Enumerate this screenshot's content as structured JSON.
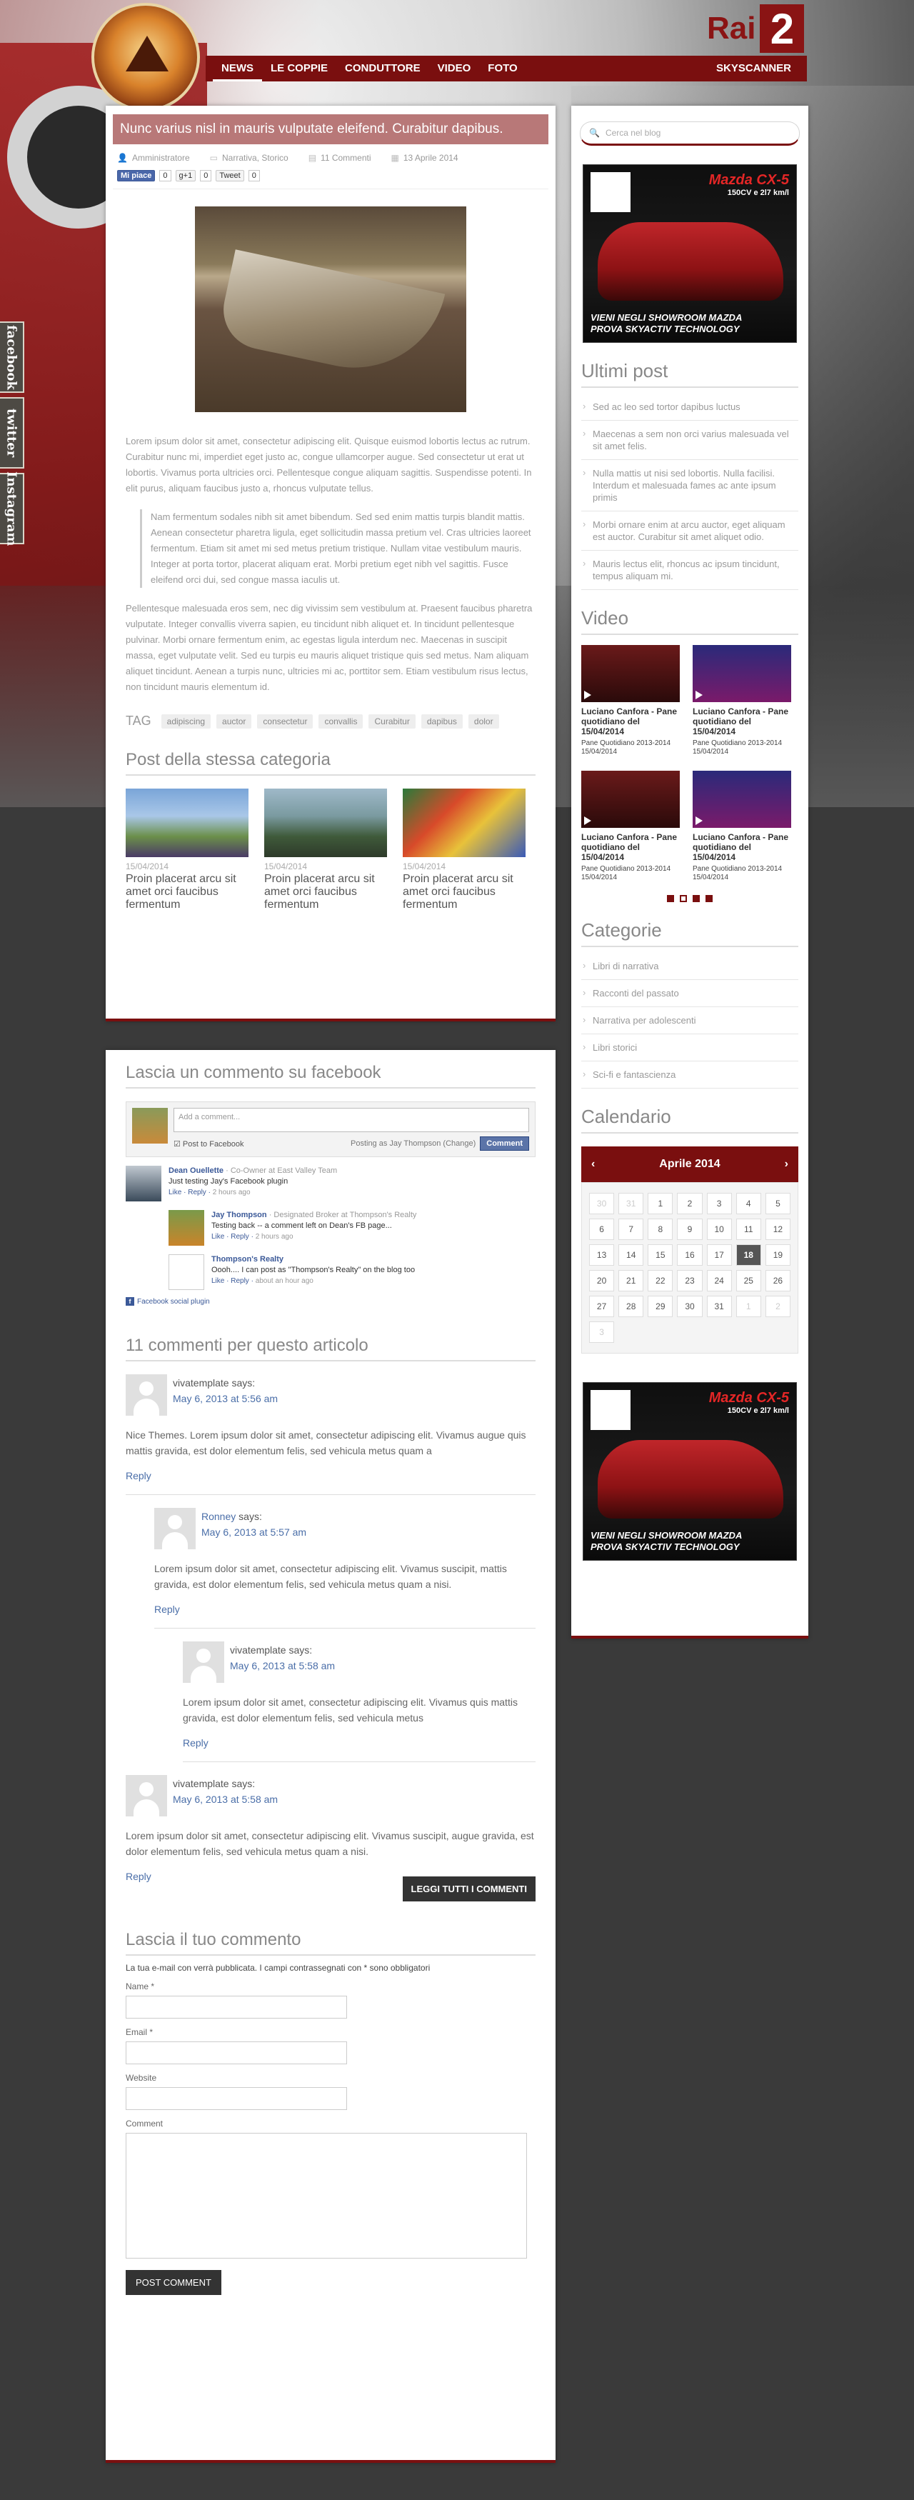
{
  "header": {
    "nav": [
      "NEWS",
      "LE COPPIE",
      "CONDUTTORE",
      "VIDEO",
      "FOTO"
    ],
    "nav_right": "SKYSCANNER",
    "brand": {
      "rai_text": "Rai",
      "rai_num": "2"
    }
  },
  "social_tabs": [
    "facebook",
    "twitter",
    "Instagram"
  ],
  "post": {
    "title": "Nunc varius nisl in mauris vulputate eleifend. Curabitur dapibus.",
    "meta": {
      "author": "Amministratore",
      "category": "Narrativa, Storico",
      "comments": "11 Commenti",
      "date": "13 Aprile 2014"
    },
    "share": {
      "fb": "Mi piace",
      "fb_count": "0",
      "gplus": "g+1",
      "gplus_count": "0",
      "tweet": "Tweet",
      "tweet_count": "0"
    },
    "paragraphs": [
      "Lorem ipsum dolor sit amet, consectetur adipiscing elit. Quisque euismod lobortis lectus ac rutrum. Curabitur nunc mi, imperdiet eget justo ac, congue ullamcorper augue. Sed consectetur ut erat ut lobortis. Vivamus porta ultricies orci. Pellentesque congue aliquam sagittis. Suspendisse potenti. In elit purus, aliquam faucibus justo a, rhoncus vulputate tellus.",
      "Nam fermentum sodales nibh sit amet bibendum. Sed sed enim mattis turpis blandit mattis. Aenean consectetur pharetra ligula, eget sollicitudin massa pretium vel. Cras ultricies laoreet fermentum. Etiam sit amet mi sed metus pretium tristique. Nullam vitae vestibulum mauris. Integer at porta tortor, placerat aliquam erat. Morbi pretium eget nibh vel sagittis. Fusce eleifend orci dui, sed congue massa iaculis ut.",
      "Pellentesque malesuada eros sem, nec dig vivissim sem vestibulum at. Praesent faucibus pharetra vulputate. Integer convallis viverra sapien, eu tincidunt nibh aliquet et. In tincidunt pellentesque pulvinar. Morbi ornare fermentum enim, ac egestas ligula interdum nec. Maecenas in suscipit massa, eget vulputate velit. Sed eu turpis eu mauris aliquet tristique quis sed metus. Nam aliquam aliquet tincidunt. Aenean a turpis nunc, ultricies mi ac, porttitor sem. Etiam vestibulum risus lectus, non tincidunt mauris elementum id."
    ],
    "tags_label": "TAG",
    "tags": [
      "adipiscing",
      "auctor",
      "consectetur",
      "convallis",
      "Curabitur",
      "dapibus",
      "dolor"
    ],
    "related_heading": "Post della stessa categoria",
    "related": [
      {
        "date": "15/04/2014",
        "title": "Proin placerat arcu sit amet orci faucibus fermentum"
      },
      {
        "date": "15/04/2014",
        "title": "Proin placerat arcu sit amet orci faucibus fermentum"
      },
      {
        "date": "15/04/2014",
        "title": "Proin placerat arcu sit amet orci faucibus fermentum"
      }
    ]
  },
  "fb_comments": {
    "heading": "Lascia un commento su facebook",
    "placeholder": "Add a comment...",
    "post_to_fb": "Post to Facebook",
    "posting_as": "Posting as Jay Thompson (Change)",
    "comment_btn": "Comment",
    "items": [
      {
        "name": "Dean Ouellette",
        "role": "· Co-Owner at East Valley Team",
        "text": "Just testing Jay's Facebook plugin",
        "actions": "Like · Reply ·",
        "time": "2 hours ago"
      },
      {
        "name": "Jay Thompson",
        "role": "· Designated Broker at Thompson's Realty",
        "text": "Testing back -- a comment left on Dean's FB page...",
        "actions": "Like · Reply ·",
        "time": "2 hours ago"
      },
      {
        "name": "Thompson's Realty",
        "role": "",
        "text": "Oooh.... I can post as \"Thompson's Realty\" on the blog too",
        "actions": "Like · Reply ·",
        "time": "about an hour ago"
      }
    ],
    "plugin": "Facebook social plugin"
  },
  "comments": {
    "heading": "11 commenti per questo articolo",
    "says": "says:",
    "reply": "Reply",
    "items": [
      {
        "author": "vivatemplate",
        "date": "May 6, 2013 at 5:56 am",
        "text": "Nice Themes. Lorem ipsum dolor sit amet, consectetur adipiscing elit. Vivamus augue quis mattis gravida, est dolor elementum felis, sed vehicula metus quam a"
      },
      {
        "author": "Ronney",
        "date": "May 6, 2013 at 5:57 am",
        "text": "Lorem ipsum dolor sit amet, consectetur adipiscing elit. Vivamus suscipit, mattis gravida, est dolor elementum felis, sed vehicula metus quam a nisi."
      },
      {
        "author": "vivatemplate",
        "date": "May 6, 2013 at 5:58 am",
        "text": "Lorem ipsum dolor sit amet, consectetur adipiscing elit. Vivamus quis mattis gravida, est dolor elementum felis, sed vehicula metus"
      },
      {
        "author": "vivatemplate",
        "date": "May 6, 2013 at 5:58 am",
        "text": "Lorem ipsum dolor sit amet, consectetur adipiscing elit. Vivamus suscipit, augue gravida, est dolor elementum felis, sed vehicula metus quam a nisi."
      }
    ],
    "read_all": "LEGGI TUTTI I COMMENTI"
  },
  "reply_form": {
    "heading": "Lascia il tuo commento",
    "note": "La tua e-mail con verrà pubblicata. I campi contrassegnati con * sono obbligatori",
    "name_label": "Name *",
    "email_label": "Email *",
    "website_label": "Website",
    "comment_label": "Comment",
    "submit": "POST COMMENT"
  },
  "sidebar": {
    "search_placeholder": "Cerca nel blog",
    "ad": {
      "title": "Mazda CX-5",
      "sub": "150CV e 2l7 km/l",
      "foot1": "VIENI NEGLI SHOWROOM MAZDA",
      "foot2": "PROVA SKYACTIV TECHNOLOGY"
    },
    "recent_heading": "Ultimi post",
    "recent": [
      "Sed ac leo sed tortor dapibus luctus",
      "Maecenas a sem non orci varius malesuada vel sit amet felis.",
      "Nulla mattis ut nisi sed lobortis. Nulla facilisi. Interdum et malesuada fames ac ante ipsum primis",
      "Morbi ornare enim at arcu auctor, eget aliquam est auctor. Curabitur sit amet aliquet odio.",
      "Mauris lectus elit, rhoncus ac ipsum tincidunt, tempus aliquam mi."
    ],
    "video_heading": "Video",
    "videos": [
      {
        "title": "Luciano Canfora - Pane quotidiano del 15/04/2014",
        "sub": "Pane Quotidiano 2013-2014 15/04/2014"
      },
      {
        "title": "Luciano Canfora - Pane quotidiano del 15/04/2014",
        "sub": "Pane Quotidiano 2013-2014 15/04/2014"
      },
      {
        "title": "Luciano Canfora - Pane quotidiano del 15/04/2014",
        "sub": "Pane Quotidiano 2013-2014 15/04/2014"
      },
      {
        "title": "Luciano Canfora - Pane quotidiano del 15/04/2014",
        "sub": "Pane Quotidiano 2013-2014 15/04/2014"
      }
    ],
    "categories_heading": "Categorie",
    "categories": [
      "Libri di narrativa",
      "Racconti del passato",
      "Narrativa per adolescenti",
      "Libri storici",
      "Sci-fi e fantascienza"
    ],
    "calendar_heading": "Calendario",
    "calendar": {
      "month": "Aprile 2014",
      "prev": "‹",
      "next": "›",
      "today": "18",
      "days": [
        "30",
        "31",
        "1",
        "2",
        "3",
        "4",
        "5",
        "6",
        "7",
        "8",
        "9",
        "10",
        "11",
        "12",
        "13",
        "14",
        "15",
        "16",
        "17",
        "18",
        "19",
        "20",
        "21",
        "22",
        "23",
        "24",
        "25",
        "26",
        "27",
        "28",
        "29",
        "30",
        "31",
        "1",
        "2",
        "3"
      ],
      "muted": [
        0,
        1,
        33,
        34,
        35
      ]
    }
  }
}
